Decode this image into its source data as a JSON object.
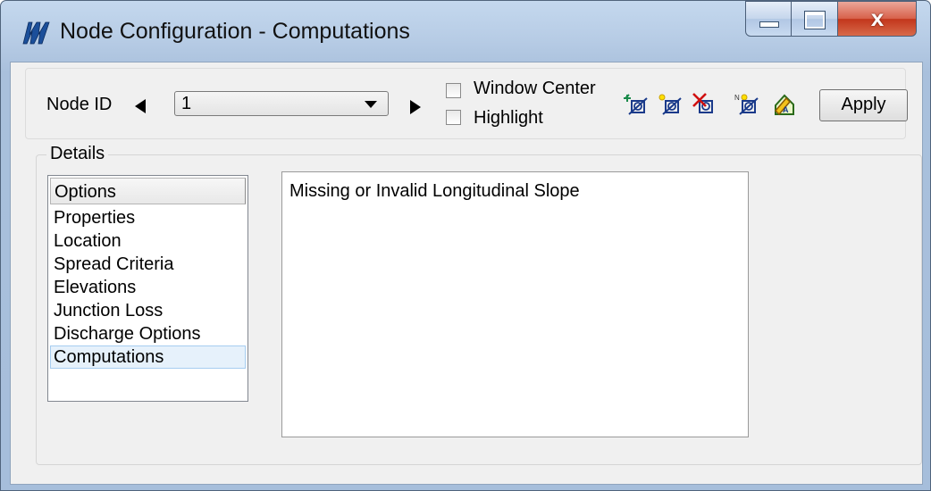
{
  "window": {
    "title": "Node Configuration - Computations",
    "controls": {
      "minimize_icon": "minimize-icon",
      "maximize_icon": "maximize-icon",
      "close_glyph": "x"
    }
  },
  "toolbar": {
    "node_id_label": "Node ID",
    "node_id_value": "1",
    "window_center_label": "Window Center",
    "highlight_label": "Highlight",
    "apply_label": "Apply"
  },
  "details": {
    "group_label": "Details",
    "options_header": "Options",
    "items": [
      {
        "label": "Properties"
      },
      {
        "label": "Location"
      },
      {
        "label": "Spread Criteria"
      },
      {
        "label": "Elevations"
      },
      {
        "label": "Junction Loss"
      },
      {
        "label": "Discharge Options"
      },
      {
        "label": "Computations",
        "selected": true
      }
    ],
    "output_text": "Missing or Invalid Longitudinal Slope"
  }
}
